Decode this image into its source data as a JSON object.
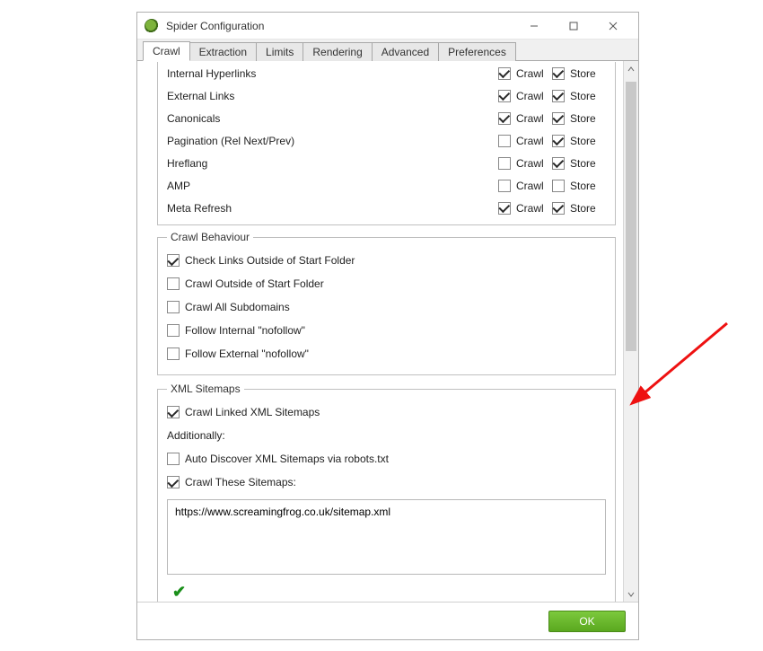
{
  "window": {
    "title": "Spider Configuration"
  },
  "tabs": [
    "Crawl",
    "Extraction",
    "Limits",
    "Rendering",
    "Advanced",
    "Preferences"
  ],
  "active_tab": 0,
  "columns": {
    "crawl": "Crawl",
    "store": "Store"
  },
  "link_rows": [
    {
      "label": "Internal Hyperlinks",
      "crawl": true,
      "store": true
    },
    {
      "label": "External Links",
      "crawl": true,
      "store": true
    },
    {
      "label": "Canonicals",
      "crawl": true,
      "store": true
    },
    {
      "label": "Pagination (Rel Next/Prev)",
      "crawl": false,
      "store": true
    },
    {
      "label": "Hreflang",
      "crawl": false,
      "store": true
    },
    {
      "label": "AMP",
      "crawl": false,
      "store": false
    },
    {
      "label": "Meta Refresh",
      "crawl": true,
      "store": true
    }
  ],
  "behaviour": {
    "legend": "Crawl Behaviour",
    "options": [
      {
        "label": "Check Links Outside of Start Folder",
        "checked": true
      },
      {
        "label": "Crawl Outside of Start Folder",
        "checked": false
      },
      {
        "label": "Crawl All Subdomains",
        "checked": false
      },
      {
        "label": "Follow Internal \"nofollow\"",
        "checked": false
      },
      {
        "label": "Follow External \"nofollow\"",
        "checked": false
      }
    ]
  },
  "xml": {
    "legend": "XML Sitemaps",
    "crawl_linked": {
      "label": "Crawl Linked XML Sitemaps",
      "checked": true
    },
    "additionally_label": "Additionally:",
    "auto_discover": {
      "label": "Auto Discover XML Sitemaps via robots.txt",
      "checked": false
    },
    "crawl_these": {
      "label": "Crawl These Sitemaps:",
      "checked": true
    },
    "sitemap_text": "https://www.screamingfrog.co.uk/sitemap.xml",
    "valid_icon": "✔"
  },
  "footer": {
    "ok": "OK"
  }
}
